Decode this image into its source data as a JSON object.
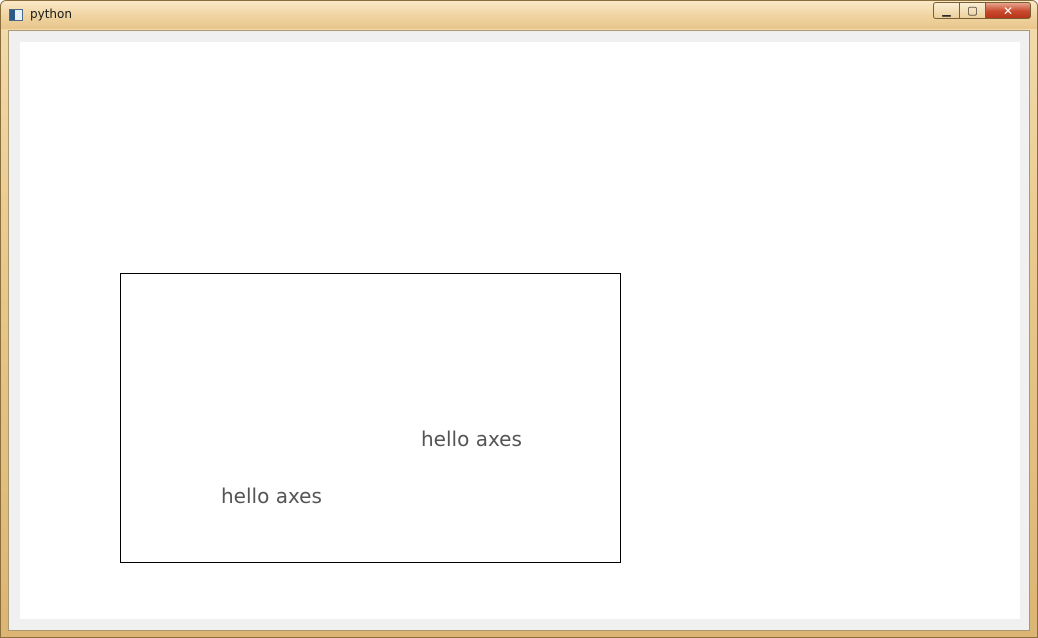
{
  "window": {
    "title": "python",
    "controls": {
      "minimize_symbol": "▁",
      "maximize_symbol": "▢",
      "close_symbol": "✕"
    }
  },
  "figure": {
    "axes": {
      "texts": [
        "hello axes",
        "hello axes"
      ]
    }
  },
  "colors": {
    "canvas_background": "#ffffff",
    "axes_border": "#000000",
    "text_color": "#555555"
  }
}
